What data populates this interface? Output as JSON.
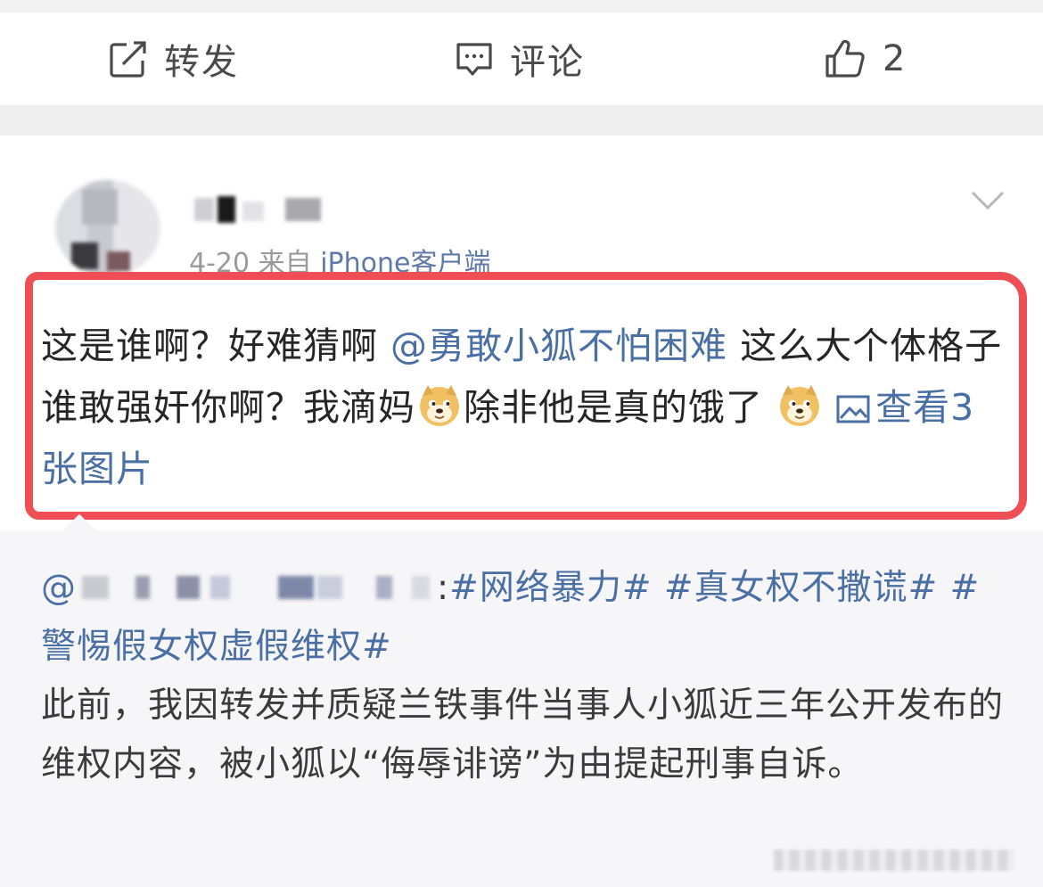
{
  "action_bar": {
    "repost": {
      "icon": "share-icon",
      "label": "转发"
    },
    "comment": {
      "icon": "comment-icon",
      "label": "评论"
    },
    "like": {
      "icon": "thumbs-up-icon",
      "count": "2"
    }
  },
  "post": {
    "meta": {
      "date": "4-20",
      "from": "来自",
      "source": "iPhone客户端"
    },
    "content": {
      "line1_a": "这是谁啊？好难猜啊",
      "mention": "@勇敢小狐不怕困难",
      "line1_b": "这么大个体格子谁敢强奸你啊？我滴妈",
      "line2_b": "除非他是真的饿了",
      "view_pics": "查看3张图片"
    },
    "emoji_icon": "doge-emoji",
    "collapse_icon": "chevron-down-icon"
  },
  "repost": {
    "at": "@",
    "colon": ":",
    "tags": "#网络暴力# #真女权不撒谎# #警惕假女权虚假维权#",
    "body": "此前，我因转发并质疑兰铁事件当事人小狐近三年公开发布的维权内容，被小狐以“侮辱诽谤”为由提起刑事自诉。"
  },
  "colors": {
    "accent_link": "#4a6fa5",
    "highlight_border": "#ee4f55"
  }
}
